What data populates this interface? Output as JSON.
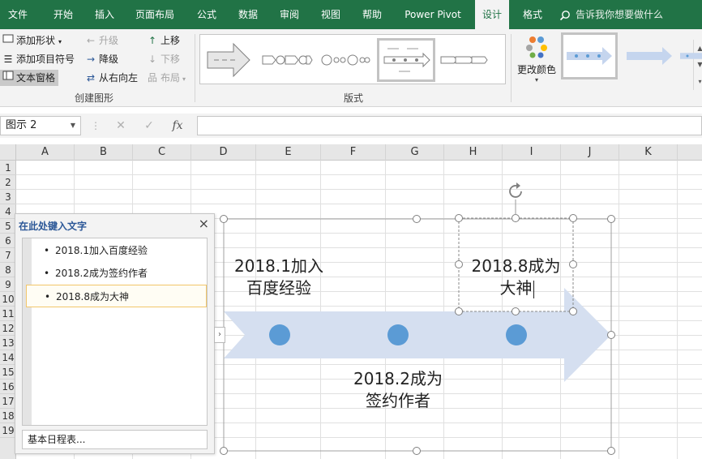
{
  "ribbon_tabs": [
    {
      "label": "文件",
      "active": false
    },
    {
      "label": "开始",
      "active": false
    },
    {
      "label": "插入",
      "active": false
    },
    {
      "label": "页面布局",
      "active": false
    },
    {
      "label": "公式",
      "active": false
    },
    {
      "label": "数据",
      "active": false
    },
    {
      "label": "审阅",
      "active": false
    },
    {
      "label": "视图",
      "active": false
    },
    {
      "label": "帮助",
      "active": false
    },
    {
      "label": "Power Pivot",
      "active": false
    },
    {
      "label": "设计",
      "active": true
    },
    {
      "label": "格式",
      "active": false
    }
  ],
  "tell_me": {
    "text": "告诉我你想要做什么",
    "icon": "lightbulb-icon"
  },
  "create_graphic": {
    "group_label": "创建图形",
    "add_shape": "添加形状",
    "add_bullet": "添加项目符号",
    "text_pane": "文本窗格",
    "promote": "升级",
    "demote": "降级",
    "right_to_left": "从右向左",
    "move_up": "上移",
    "move_down": "下移",
    "layout": "布局"
  },
  "layouts_group": {
    "label": "版式"
  },
  "change_colors": {
    "label": "更改颜色"
  },
  "formula_bar": {
    "name_box": "图示 2",
    "fx_label": "fx",
    "cancel_glyph": "✕",
    "enter_glyph": "✓",
    "value": ""
  },
  "columns": [
    "A",
    "B",
    "C",
    "D",
    "E",
    "F",
    "G",
    "H",
    "I",
    "J",
    "K"
  ],
  "rows": [
    "1",
    "2",
    "3",
    "4",
    "5",
    "6",
    "7",
    "8",
    "9",
    "10",
    "11",
    "12",
    "13",
    "14",
    "15",
    "16",
    "17",
    "18",
    "19"
  ],
  "text_pane": {
    "title": "在此处键入文字",
    "close_glyph": "×",
    "items": [
      {
        "text": "2018.1加入百度经验",
        "selected": false
      },
      {
        "text": "2018.2成为签约作者",
        "selected": false
      },
      {
        "text": "2018.8成为大神",
        "selected": true
      }
    ],
    "footer_link": "基本日程表..."
  },
  "smartart": {
    "fill_color": "#d5dff0",
    "dot_color": "#5b9bd5",
    "labels": [
      {
        "text": "2018.1加入\n百度经验"
      },
      {
        "text": "2018.2成为\n签约作者"
      },
      {
        "text": "2018.8成为\n大神"
      }
    ]
  }
}
